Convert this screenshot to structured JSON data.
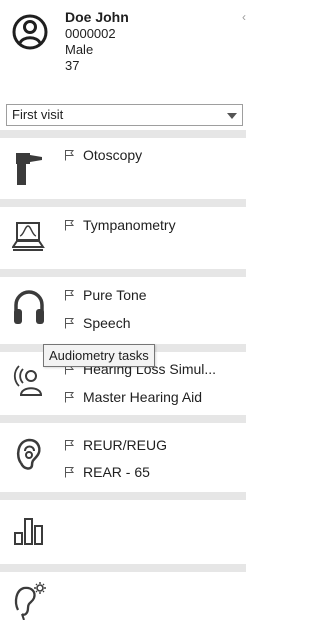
{
  "patient": {
    "name": "Doe John",
    "id": "0000002",
    "gender": "Male",
    "age": "37"
  },
  "visit_select": {
    "value": "First visit"
  },
  "sections": {
    "otoscopy": {
      "items": [
        "Otoscopy"
      ]
    },
    "tympanometry": {
      "items": [
        "Tympanometry"
      ]
    },
    "audiometry": {
      "items": [
        "Pure Tone",
        "Speech"
      ],
      "tooltip": "Audiometry tasks"
    },
    "hearing_loss": {
      "items": [
        "Hearing Loss Simul...",
        "Master Hearing Aid"
      ]
    },
    "rem": {
      "items": [
        "REUR/REUG",
        "REAR - 65"
      ]
    }
  },
  "colors": {
    "separator": "#e6e6e6",
    "icon": "#3b3b3b"
  }
}
